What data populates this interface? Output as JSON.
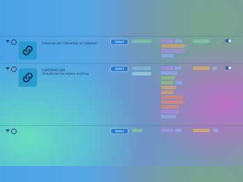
{
  "rows": [
    {
      "title": "instances.com / Generator w/ clipboard",
      "subtitle": "",
      "select_label": "Select"
    },
    {
      "title": "CHATOPSIO.COM",
      "subtitle": "Ultimate tool for replace anything",
      "select_label": "Select"
    },
    {
      "title": "",
      "subtitle": "",
      "select_label": "Select"
    }
  ],
  "colors": {
    "accent": "#2f7fd0",
    "thumbnail": "#2a9ad3"
  },
  "icons": {
    "row_expand": "chevron-down-icon",
    "row_settings": "gear-icon",
    "thumbnail": "link-icon",
    "toggle": "toggle-switch"
  }
}
